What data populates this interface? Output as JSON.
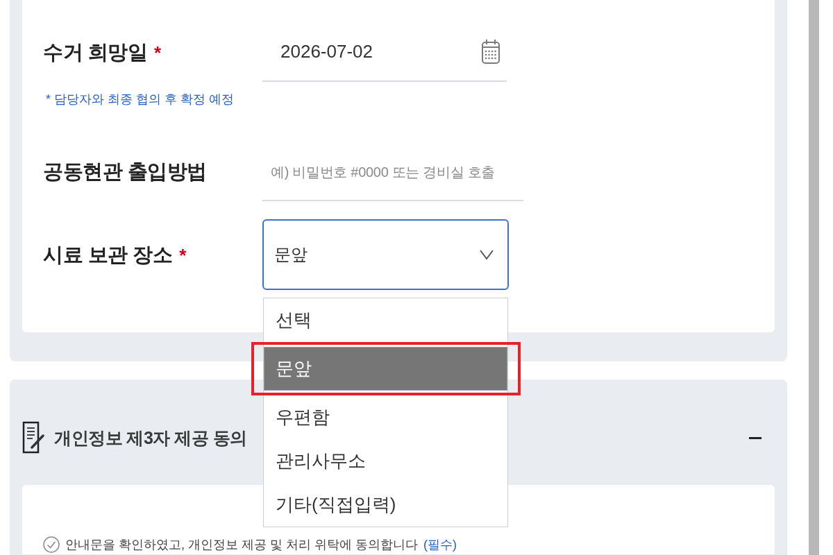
{
  "form_section": {
    "fields": [
      {
        "kind": "date",
        "label": "수거 희망일",
        "required_mark": "*",
        "value": "2026-07-02",
        "note": "* 담당자와 최종 협의 후 확정 예정"
      },
      {
        "kind": "text",
        "label": "공동현관 출입방법",
        "placeholder": "예) 비밀번호 #0000 또는 경비실 호출"
      },
      {
        "kind": "select",
        "label": "시료 보관 장소",
        "required_mark": "*",
        "value": "문앞",
        "expanded": true,
        "options": [
          {
            "label": "선택",
            "selected": false,
            "highlighted": false
          },
          {
            "label": "문앞",
            "selected": true,
            "highlighted": true
          },
          {
            "label": "우편함",
            "selected": false,
            "highlighted": false
          },
          {
            "label": "관리사무소",
            "selected": false,
            "highlighted": false
          },
          {
            "label": "기타(직접입력)",
            "selected": false,
            "highlighted": false
          }
        ]
      }
    ]
  },
  "consent_section": {
    "title": "개인정보 제3자 제공 동의",
    "expanded": true,
    "consent": {
      "checked": false,
      "text": "안내문을 확인하였고, 개인정보 제공 및 처리 위탁에 동의합니다",
      "tag": "(필수)"
    }
  }
}
